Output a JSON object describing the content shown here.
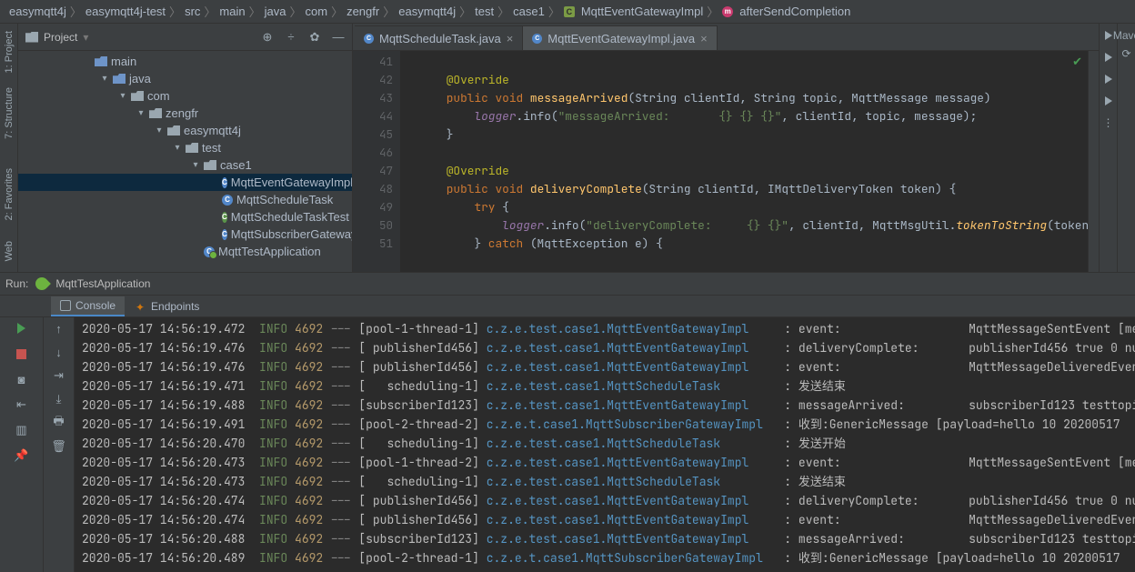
{
  "breadcrumbs": [
    {
      "label": "easymqtt4j"
    },
    {
      "label": "easymqtt4j-test"
    },
    {
      "label": "src"
    },
    {
      "label": "main"
    },
    {
      "label": "java"
    },
    {
      "label": "com"
    },
    {
      "label": "zengfr"
    },
    {
      "label": "easymqtt4j"
    },
    {
      "label": "test"
    },
    {
      "label": "case1"
    },
    {
      "label": "MqttEventGatewayImpl",
      "icon": "class"
    },
    {
      "label": "afterSendCompletion",
      "icon": "method"
    }
  ],
  "left_tabs": {
    "project": "1: Project",
    "structure": "7: Structure",
    "favorites": "2: Favorites",
    "web": "Web"
  },
  "right_tabs": {
    "maven": "Mave"
  },
  "project_header": {
    "title": "Project"
  },
  "tree": {
    "l0": "main",
    "l1": "java",
    "l2": "com",
    "l3": "zengfr",
    "l4": "easymqtt4j",
    "l5": "test",
    "l6": "case1",
    "f0": "MqttEventGatewayImpl",
    "f1": "MqttScheduleTask",
    "f2": "MqttScheduleTaskTest",
    "f3": "MqttSubscriberGatewayIm",
    "f4": "MqttTestApplication"
  },
  "editor_tabs": {
    "t0": "MqttScheduleTask.java",
    "t1": "MqttEventGatewayImpl.java"
  },
  "gutter": [
    "41",
    "42",
    "43",
    "44",
    "45",
    "46",
    "47",
    "48",
    "49",
    "50",
    "51"
  ],
  "code": {
    "l42_ann": "@Override",
    "l43_public": "public",
    "l43_void": "void",
    "l43_method": "messageArrived",
    "l43_sig": "(String clientId, String topic, MqttMessage message)",
    "l44_logger": "logger",
    "l44_info": ".info(",
    "l44_str": "\"messageArrived:       {} {} {}\"",
    "l44_rest": ", clientId, topic, message);",
    "l45_brace": "}",
    "l47_ann": "@Override",
    "l48_public": "public",
    "l48_void": "void",
    "l48_method": "deliveryComplete",
    "l48_sig": "(String clientId, IMqttDeliveryToken token) {",
    "l49_try": "try",
    "l49_brace": " {",
    "l50_logger": "logger",
    "l50_info": ".info(",
    "l50_str": "\"deliveryComplete:     {} {}\"",
    "l50_rest": ", clientId, MqttMsgUtil.",
    "l50_m2": "tokenToString",
    "l50_end": "(token)",
    "l51_catch": "} ",
    "l51_kw": "catch",
    "l51_rest": " (MqttException e) {"
  },
  "run": {
    "title_label": "Run:",
    "config": "MqttTestApplication",
    "tab_console": "Console",
    "tab_endpoints": "Endpoints"
  },
  "console_lines": [
    {
      "ts": "2020-05-17 14:56:19.472",
      "lvl": "INFO",
      "pid": "4692",
      "thr": "[pool-1-thread-1]",
      "logger": "c.z.e.test.case1.MqttEventGatewayImpl",
      "msg": "event:",
      "extra": "MqttMessageSentEvent [me"
    },
    {
      "ts": "2020-05-17 14:56:19.476",
      "lvl": "INFO",
      "pid": "4692",
      "thr": "[ publisherId456]",
      "logger": "c.z.e.test.case1.MqttEventGatewayImpl",
      "msg": "deliveryComplete:",
      "extra": "publisherId456 true 0 nu"
    },
    {
      "ts": "2020-05-17 14:56:19.476",
      "lvl": "INFO",
      "pid": "4692",
      "thr": "[ publisherId456]",
      "logger": "c.z.e.test.case1.MqttEventGatewayImpl",
      "msg": "event:",
      "extra": "MqttMessageDeliveredEven"
    },
    {
      "ts": "2020-05-17 14:56:19.471",
      "lvl": "INFO",
      "pid": "4692",
      "thr": "[   scheduling-1]",
      "logger": "c.z.e.test.case1.MqttScheduleTask",
      "msg": "发送结束",
      "extra": ""
    },
    {
      "ts": "2020-05-17 14:56:19.488",
      "lvl": "INFO",
      "pid": "4692",
      "thr": "[subscriberId123]",
      "logger": "c.z.e.test.case1.MqttEventGatewayImpl",
      "msg": "messageArrived:",
      "extra": "subscriberId123 testtopi"
    },
    {
      "ts": "2020-05-17 14:56:19.491",
      "lvl": "INFO",
      "pid": "4692",
      "thr": "[pool-2-thread-2]",
      "logger": "c.z.e.t.case1.MqttSubscriberGatewayImpl",
      "msg": "收到:GenericMessage [payload=hello 10 20200517",
      "extra": ""
    },
    {
      "ts": "2020-05-17 14:56:20.470",
      "lvl": "INFO",
      "pid": "4692",
      "thr": "[   scheduling-1]",
      "logger": "c.z.e.test.case1.MqttScheduleTask",
      "msg": "发送开始",
      "extra": ""
    },
    {
      "ts": "2020-05-17 14:56:20.473",
      "lvl": "INFO",
      "pid": "4692",
      "thr": "[pool-1-thread-2]",
      "logger": "c.z.e.test.case1.MqttEventGatewayImpl",
      "msg": "event:",
      "extra": "MqttMessageSentEvent [me"
    },
    {
      "ts": "2020-05-17 14:56:20.473",
      "lvl": "INFO",
      "pid": "4692",
      "thr": "[   scheduling-1]",
      "logger": "c.z.e.test.case1.MqttScheduleTask",
      "msg": "发送结束",
      "extra": ""
    },
    {
      "ts": "2020-05-17 14:56:20.474",
      "lvl": "INFO",
      "pid": "4692",
      "thr": "[ publisherId456]",
      "logger": "c.z.e.test.case1.MqttEventGatewayImpl",
      "msg": "deliveryComplete:",
      "extra": "publisherId456 true 0 nu"
    },
    {
      "ts": "2020-05-17 14:56:20.474",
      "lvl": "INFO",
      "pid": "4692",
      "thr": "[ publisherId456]",
      "logger": "c.z.e.test.case1.MqttEventGatewayImpl",
      "msg": "event:",
      "extra": "MqttMessageDeliveredEven"
    },
    {
      "ts": "2020-05-17 14:56:20.488",
      "lvl": "INFO",
      "pid": "4692",
      "thr": "[subscriberId123]",
      "logger": "c.z.e.test.case1.MqttEventGatewayImpl",
      "msg": "messageArrived:",
      "extra": "subscriberId123 testtopi"
    },
    {
      "ts": "2020-05-17 14:56:20.489",
      "lvl": "INFO",
      "pid": "4692",
      "thr": "[pool-2-thread-1]",
      "logger": "c.z.e.t.case1.MqttSubscriberGatewayImpl",
      "msg": "收到:GenericMessage [payload=hello 10 20200517",
      "extra": ""
    }
  ]
}
